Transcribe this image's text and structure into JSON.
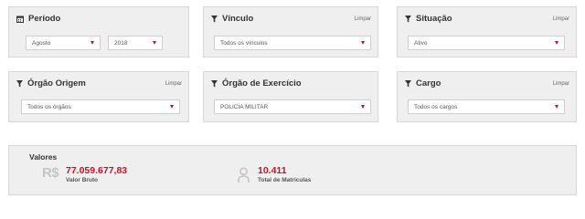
{
  "filters": {
    "periodo": {
      "title": "Período",
      "month": "Agosto",
      "year": "2018"
    },
    "vinculo": {
      "title": "Vínculo",
      "clear_label": "Limpar",
      "value": "Todos os vínculos"
    },
    "situacao": {
      "title": "Situação",
      "clear_label": "Limpar",
      "value": "Ativo"
    },
    "orgao_origem": {
      "title": "Órgão Origem",
      "clear_label": "Limpar",
      "value": "Todos os órgãos"
    },
    "orgao_exercicio": {
      "title": "Órgão de Exercício",
      "clear_label": "Limpar",
      "value": "POLICIA MILITAR"
    },
    "cargo": {
      "title": "Cargo",
      "clear_label": "Limpar",
      "value": "Todos os cargos"
    }
  },
  "values": {
    "title": "Valores",
    "valor_bruto": {
      "icon": "R$",
      "value": "77.059.677,83",
      "label": "Valor Bruto"
    },
    "matriculas": {
      "icon": "person-icon",
      "value": "10.411",
      "label": "Total de Matrículas"
    }
  },
  "colors": {
    "accent": "#c8102e",
    "panel_bg": "#efefef",
    "border": "#d6d6d6"
  }
}
